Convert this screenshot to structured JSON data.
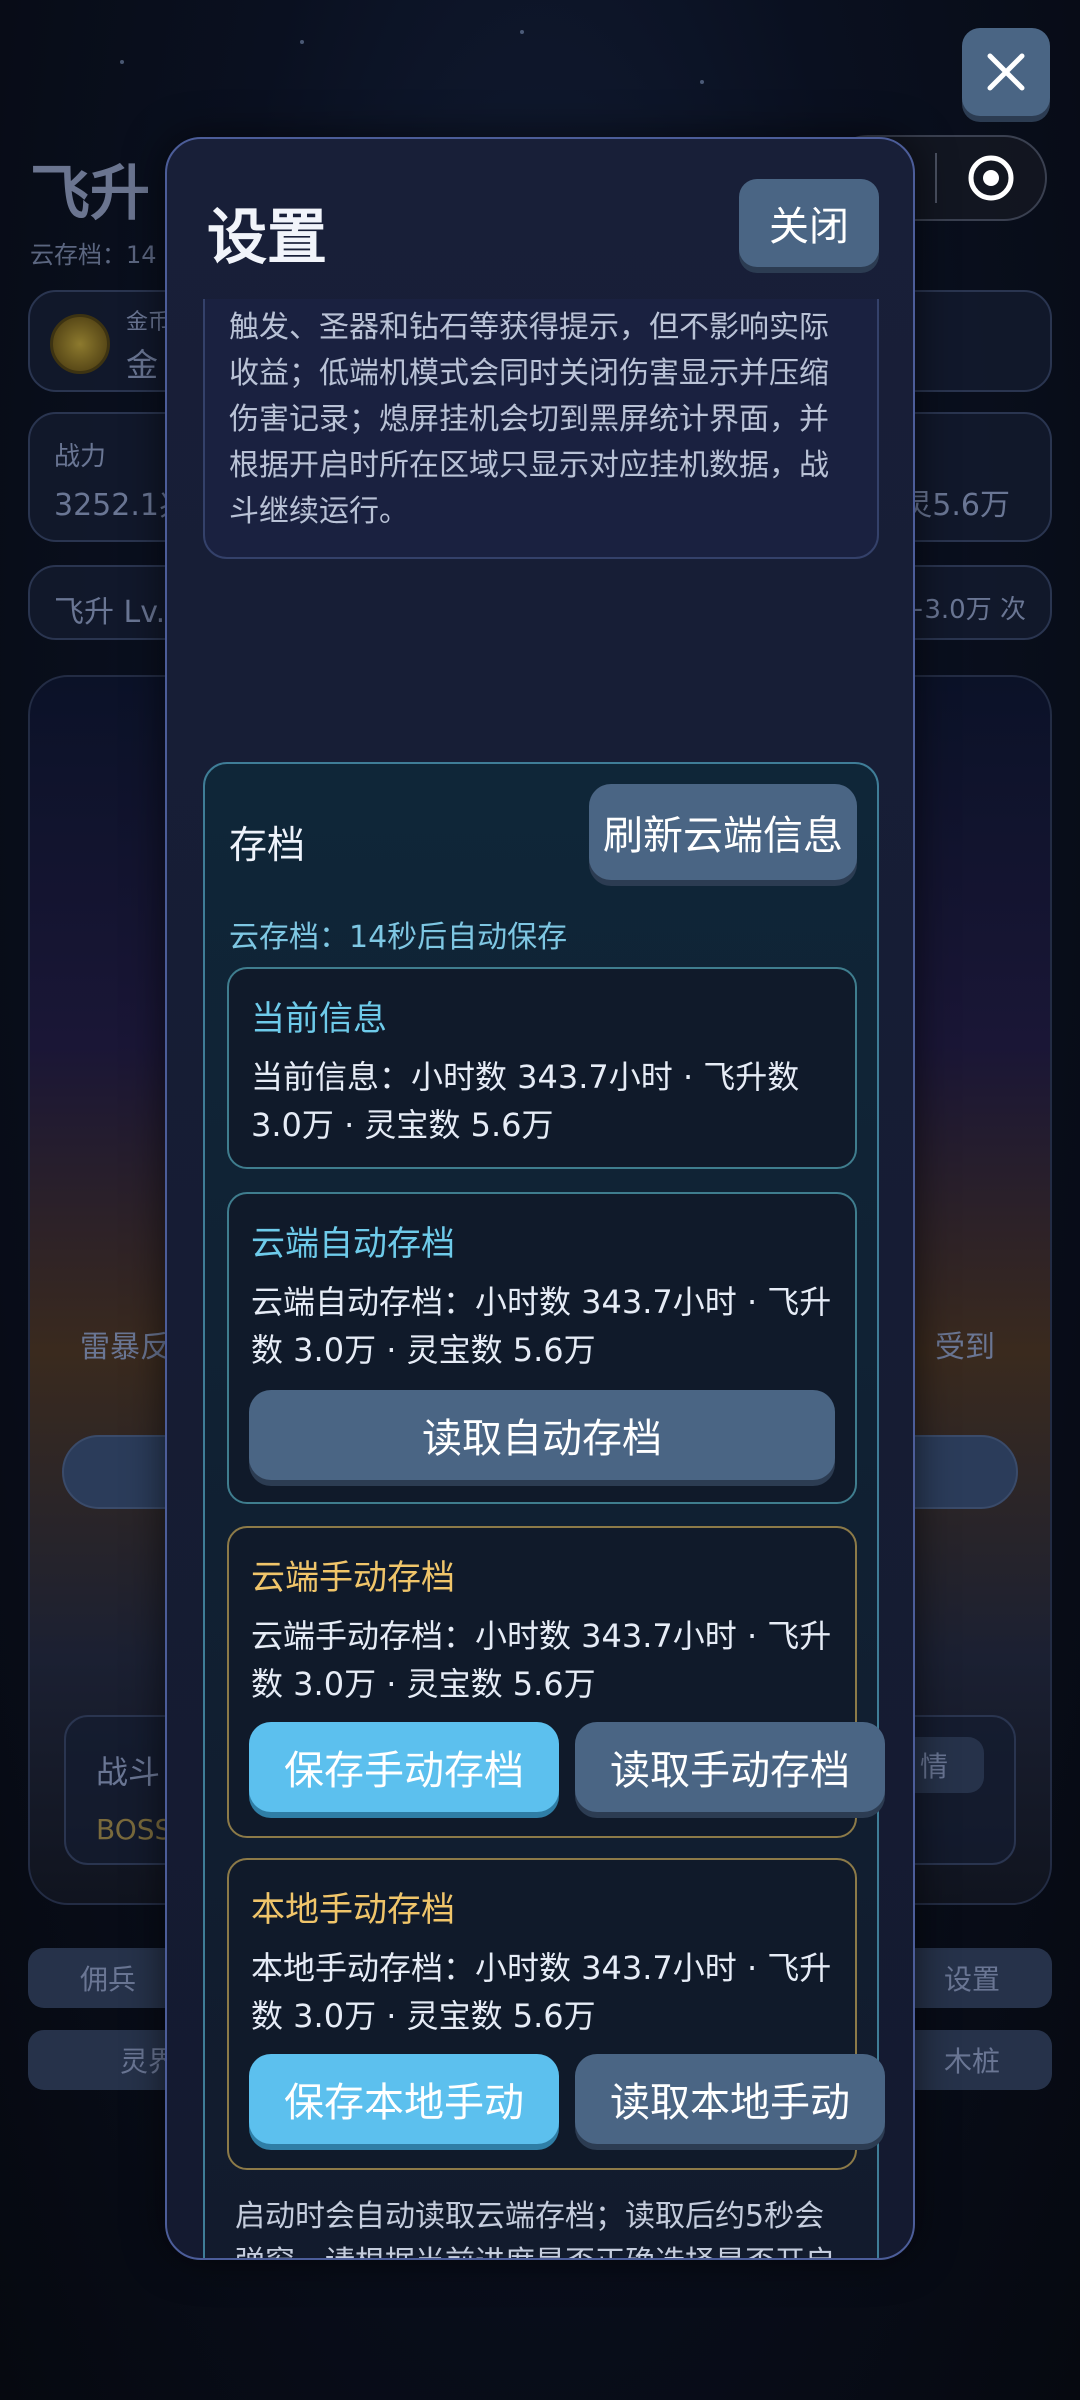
{
  "background": {
    "title": "飞升",
    "subtitle": "云存档：14",
    "gold_label": "金币",
    "gold_value": "金",
    "power_label": "战力",
    "power_value": "3252.1兆",
    "power_right": "灵5.6万",
    "ascend_label": "飞升 Lv.",
    "ascend_right": "+3.0万 次",
    "thunder_label": "雷暴反",
    "hit_label": "受到",
    "battle_label": "战斗",
    "boss_label": "BOSS",
    "detail_label": "情",
    "tab_mercenary": "佣兵",
    "tab_settings": "设置",
    "tab_lingjie": "灵界",
    "tab_dummy": "木桩"
  },
  "modal": {
    "title": "设置",
    "close_label": "关闭",
    "settings_description": "传统与像素之间切换；关闭伤害显示可减少战斗飘字；关闭技能及资源获得显示会隐藏技能触发、圣器和钻石等获得提示，但不影响实际收益；低端机模式会同时关闭伤害显示并压缩伤害记录；熄屏挂机会切到黑屏统计界面，并根据开启时所在区域只显示对应挂机数据，战斗继续运行。",
    "save_section": {
      "title": "存档",
      "refresh_label": "刷新云端信息",
      "cloud_status": "云存档：14秒后自动保存",
      "current_info": {
        "title": "当前信息",
        "body": "当前信息：小时数 343.7小时 · 飞升数 3.0万 · 灵宝数 5.6万"
      },
      "cloud_auto": {
        "title": "云端自动存档",
        "body": "云端自动存档：小时数 343.7小时 · 飞升数 3.0万 · 灵宝数 5.6万",
        "load_label": "读取自动存档"
      },
      "cloud_manual": {
        "title": "云端手动存档",
        "body": "云端手动存档：小时数 343.7小时 · 飞升数 3.0万 · 灵宝数 5.6万",
        "save_label": "保存手动存档",
        "load_label": "读取手动存档"
      },
      "local_manual": {
        "title": "本地手动存档",
        "body": "本地手动存档：小时数 343.7小时 · 飞升数 3.0万 · 灵宝数 5.6万",
        "save_label": "保存本地手动",
        "load_label": "读取本地手动"
      },
      "footer_note": "启动时会自动读取云端存档；读取后约5秒会弹窗，请根据当前进度是否正确选择是否开启云存档自动同步。刷新云端信息只会查看云端自动/手动存档的小时数、飞升数和灵宝数，不会"
    }
  },
  "icons": {
    "close": "close-icon",
    "more": "more-dots-icon",
    "target": "target-icon"
  },
  "colors": {
    "accent_cyan": "#5cc0ee",
    "button_slate": "#4a6584",
    "title_teal": "#6ecbea",
    "title_gold": "#f0c56a"
  }
}
